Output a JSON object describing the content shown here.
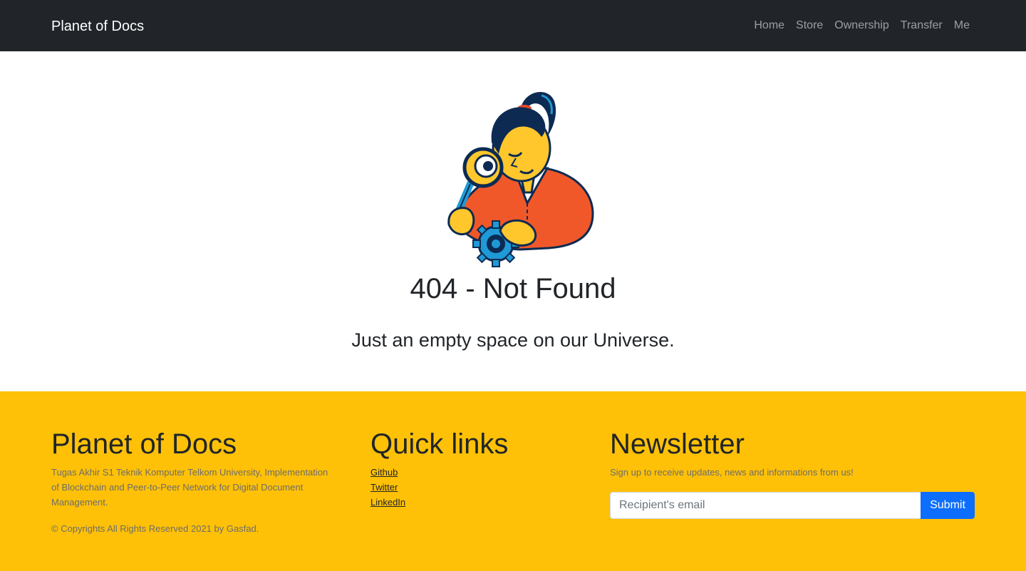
{
  "navbar": {
    "brand": "Planet of Docs",
    "links": [
      "Home",
      "Store",
      "Ownership",
      "Transfer",
      "Me"
    ]
  },
  "main": {
    "illustration": "woman-with-magnifying-glass-and-gear",
    "title": "404 - Not Found",
    "subtitle": "Just an empty space on our Universe."
  },
  "footer": {
    "about": {
      "heading": "Planet of Docs",
      "text": "Tugas Akhir S1 Teknik Komputer Telkom University, Implementation of Blockchain and Peer-to-Peer Network for Digital Document Management.",
      "copyright": "© Copyrights All Rights Reserved 2021 by Gasfad."
    },
    "quick_links": {
      "heading": "Quick links",
      "links": [
        "Github",
        "Twitter",
        "LinkedIn"
      ]
    },
    "newsletter": {
      "heading": "Newsletter",
      "text": "Sign up to receive updates, news and informations from us!",
      "input_placeholder": "Recipient's email",
      "input_value": "",
      "submit_label": "Submit"
    }
  },
  "colors": {
    "navbar_bg": "#212529",
    "footer_bg": "#ffc107",
    "button_bg": "#0d6efd"
  }
}
